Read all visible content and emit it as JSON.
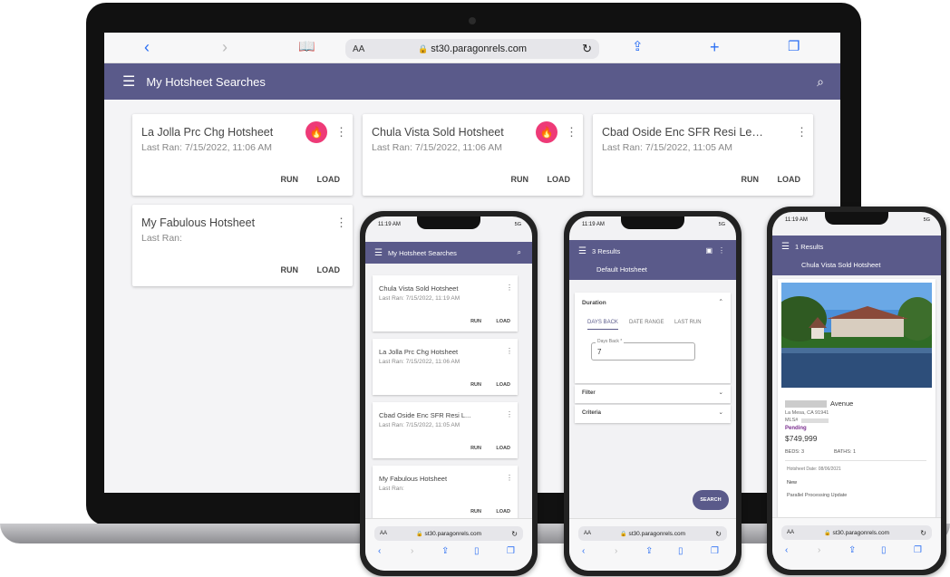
{
  "browser": {
    "url": "st30.paragonrels.com",
    "aa": "AA"
  },
  "laptop": {
    "app_title": "My Hotsheet Searches",
    "cards": [
      {
        "title": "La Jolla Prc Chg Hotsheet",
        "sub": "Last Ran: 7/15/2022, 11:06 AM",
        "run": "RUN",
        "load": "LOAD"
      },
      {
        "title": "Chula Vista Sold Hotsheet",
        "sub": "Last Ran: 7/15/2022, 11:06 AM",
        "run": "RUN",
        "load": "LOAD"
      },
      {
        "title": "Cbad Oside Enc SFR Resi Lea...",
        "sub": "Last Ran: 7/15/2022, 11:05 AM",
        "run": "RUN",
        "load": "LOAD"
      },
      {
        "title": "My Fabulous Hotsheet",
        "sub": "Last Ran:",
        "run": "RUN",
        "load": "LOAD"
      }
    ]
  },
  "phone1": {
    "time": "11:19 AM",
    "signal": "5G",
    "app_title": "My Hotsheet Searches",
    "cards": [
      {
        "title": "Chula Vista Sold Hotsheet",
        "sub": "Last Ran: 7/15/2022, 11:19 AM",
        "run": "RUN",
        "load": "LOAD"
      },
      {
        "title": "La Jolla Prc Chg Hotsheet",
        "sub": "Last Ran: 7/15/2022, 11:06 AM",
        "run": "RUN",
        "load": "LOAD"
      },
      {
        "title": "Cbad Oside Enc SFR Resi L...",
        "sub": "Last Ran: 7/15/2022, 11:05 AM",
        "run": "RUN",
        "load": "LOAD"
      },
      {
        "title": "My Fabulous Hotsheet",
        "sub": "Last Ran:",
        "run": "RUN",
        "load": "LOAD"
      }
    ]
  },
  "phone2": {
    "time": "11:19 AM",
    "signal": "5G",
    "results": "3 Results",
    "subtitle": "Default Hotsheet",
    "duration": "Duration",
    "tabs": [
      "DAYS BACK",
      "DATE RANGE",
      "LAST RUN"
    ],
    "field_label": "Days Back *",
    "field_value": "7",
    "filter": "Filter",
    "criteria": "Criteria",
    "search_btn": "SEARCH"
  },
  "phone3": {
    "time": "11:19 AM",
    "signal": "5G",
    "results": "1 Results",
    "subtitle": "Chula Vista Sold Hotsheet",
    "street": "Avenue",
    "city": "La Mesa, CA 91941",
    "mls": "MLS#",
    "status": "Pending",
    "price": "$749,999",
    "beds": "BEDS: 3",
    "baths": "BATHS: 1",
    "hotsheet_date": "Hotsheet Date: 08/06/2021",
    "new": "New",
    "update": "Parallel Processing Update"
  },
  "colors": {
    "appbar": "#5a5a8a",
    "fire": "#ee3a77",
    "link": "#2b6ff3",
    "pending": "#7b2f8f"
  }
}
